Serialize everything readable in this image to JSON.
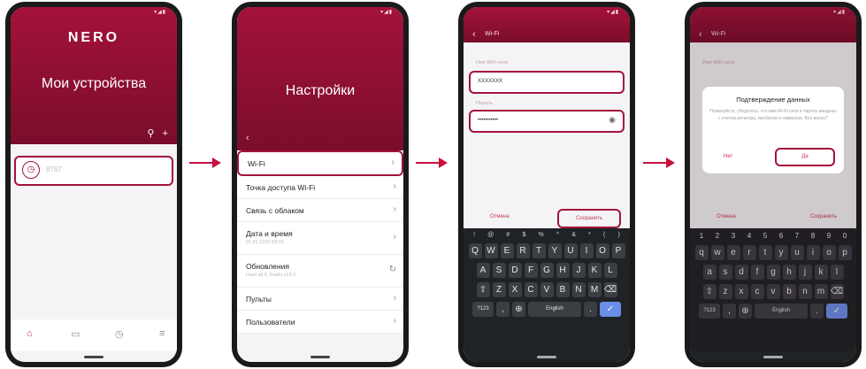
{
  "screen1": {
    "logo": "NERO",
    "title": "Мои устройства",
    "device_name": "8767",
    "search_icon": "search-icon",
    "add_icon": "plus-icon"
  },
  "screen2": {
    "title": "Настройки",
    "items": [
      {
        "label": "Wi-Fi",
        "sub": ""
      },
      {
        "label": "Точка доступа Wi-Fi",
        "sub": ""
      },
      {
        "label": "Связь с облаком",
        "sub": ""
      },
      {
        "label": "Дата и время",
        "sub": "01.01.2220 03:01"
      },
      {
        "label": "Обновления",
        "sub": "Hard v8.0, Radio v13.0"
      },
      {
        "label": "Пульты",
        "sub": ""
      },
      {
        "label": "Пользователи",
        "sub": ""
      }
    ]
  },
  "screen3": {
    "title": "Wi-Fi",
    "ssid_label": "Имя WiFi-сети",
    "ssid_value": "XXXXXXX",
    "password_label": "Пароль",
    "password_value": "•••••••••••",
    "cancel": "Отмена",
    "save": "Сохранить"
  },
  "screen4": {
    "title": "Wi-Fi",
    "ssid_label": "Имя WiFi-сети",
    "dialog_title": "Подтверждение данных",
    "dialog_text": "Пожалуйста, убедитесь, что имя Wi-Fi сети и пароль введены с учетом регистра, пробелов и символов. Всё верно?",
    "no": "Нет",
    "yes": "Да",
    "cancel": "Отмена",
    "save": "Сохранить"
  },
  "keyboard": {
    "symbols": [
      "!",
      "@",
      "#",
      "$",
      "%",
      "^",
      "&",
      "*",
      "(",
      ")"
    ],
    "numbers": [
      "1",
      "2",
      "3",
      "4",
      "5",
      "6",
      "7",
      "8",
      "9",
      "0"
    ],
    "row1_upper": [
      "Q",
      "W",
      "E",
      "R",
      "T",
      "Y",
      "U",
      "I",
      "O",
      "P"
    ],
    "row2_upper": [
      "A",
      "S",
      "D",
      "F",
      "G",
      "H",
      "J",
      "K",
      "L"
    ],
    "row3_upper": [
      "Z",
      "X",
      "C",
      "V",
      "B",
      "N",
      "M"
    ],
    "row1_lower": [
      "q",
      "w",
      "e",
      "r",
      "t",
      "y",
      "u",
      "i",
      "o",
      "p"
    ],
    "row2_lower": [
      "a",
      "s",
      "d",
      "f",
      "g",
      "h",
      "j",
      "k",
      "l"
    ],
    "row3_lower": [
      "z",
      "x",
      "c",
      "v",
      "b",
      "n",
      "m"
    ],
    "mode_key": "?123",
    "space": "English"
  },
  "colors": {
    "brand": "#a4123a",
    "arrow": "#c8103e"
  }
}
